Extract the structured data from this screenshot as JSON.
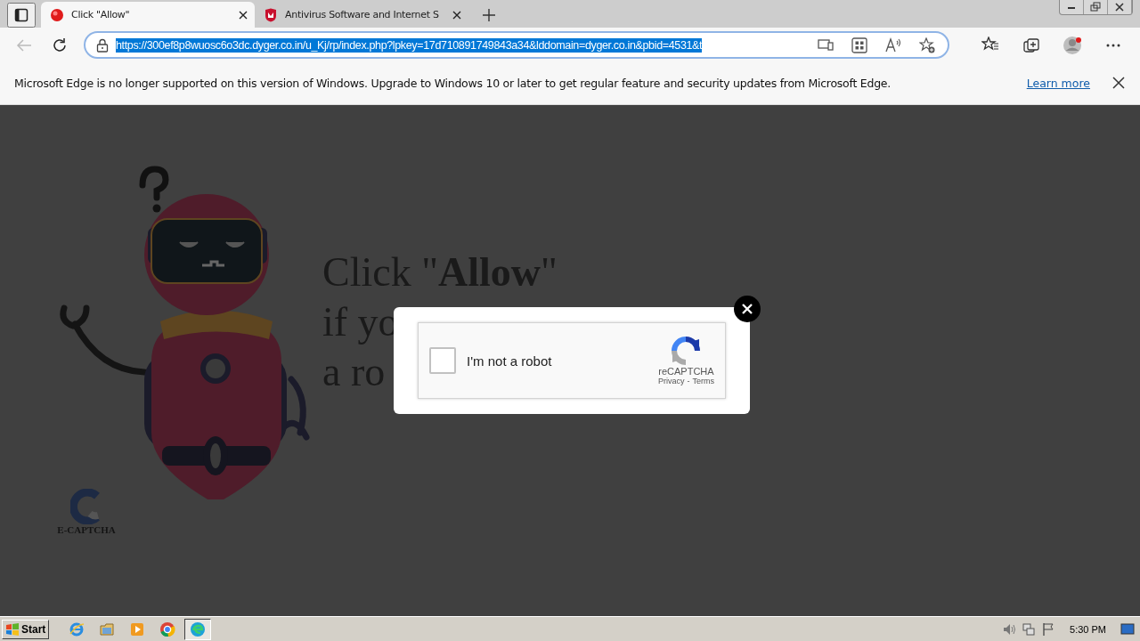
{
  "tabs": [
    {
      "title": "Click \"Allow\"",
      "selected": true,
      "kind": "alert"
    },
    {
      "title": "Antivirus Software and Internet S",
      "selected": false,
      "kind": "shield"
    }
  ],
  "address_bar": {
    "url": "https://300ef8p8wuosc6o3dc.dyger.co.in/u_Kj/rp/index.php?lpkey=17d710891749843a34&lddomain=dyger.co.in&pbid=4531&t",
    "selected": true
  },
  "info_bar": {
    "message": "Microsoft Edge is no longer supported on this version of Windows. Upgrade to Windows 10 or later to get regular feature and security updates from Microsoft Edge.",
    "link": "Learn more"
  },
  "page": {
    "headline": [
      "Click \"**Allow**\"",
      "if yo",
      "a ro"
    ],
    "logo_text": "E-CAPTCHA"
  },
  "captcha": {
    "label": "I'm not a robot",
    "checked": false,
    "brand": "reCAPTCHA",
    "links": [
      "Privacy",
      "Terms"
    ],
    "separator": "-"
  },
  "taskbar": {
    "start": "Start",
    "apps": [
      {
        "kind": "ie",
        "active": false
      },
      {
        "kind": "folder",
        "active": false
      },
      {
        "kind": "media",
        "active": false
      },
      {
        "kind": "chrome",
        "active": false
      },
      {
        "kind": "edge",
        "active": true
      }
    ],
    "clock": "5:30 PM"
  }
}
